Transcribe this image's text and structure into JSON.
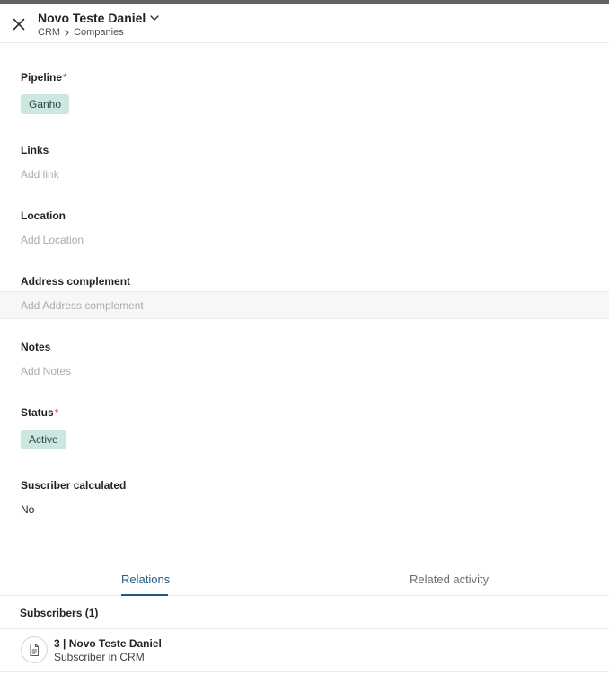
{
  "header": {
    "title": "Novo Teste Daniel",
    "breadcrumb": [
      "CRM",
      "Companies"
    ]
  },
  "fields": {
    "pipeline": {
      "label": "Pipeline",
      "required_mark": "*",
      "value": "Ganho"
    },
    "links": {
      "label": "Links",
      "placeholder": "Add link"
    },
    "location": {
      "label": "Location",
      "placeholder": "Add Location"
    },
    "address_complement": {
      "label": "Address complement",
      "placeholder": "Add Address complement"
    },
    "notes": {
      "label": "Notes",
      "placeholder": "Add Notes"
    },
    "status": {
      "label": "Status",
      "required_mark": "*",
      "value": "Active"
    },
    "subscriber_calculated": {
      "label": "Suscriber calculated",
      "value": "No"
    }
  },
  "tabs": [
    {
      "label": "Relations",
      "active": true
    },
    {
      "label": "Related activity",
      "active": false
    }
  ],
  "relations": {
    "section_title": "Subscribers (1)",
    "items": [
      {
        "title": "3 | Novo Teste Daniel",
        "subtitle": "Subscriber in CRM",
        "icon": "document-icon"
      }
    ]
  },
  "colors": {
    "accent": "#1e5b86",
    "chip_bg": "#cde6e0",
    "required": "#d13438"
  }
}
